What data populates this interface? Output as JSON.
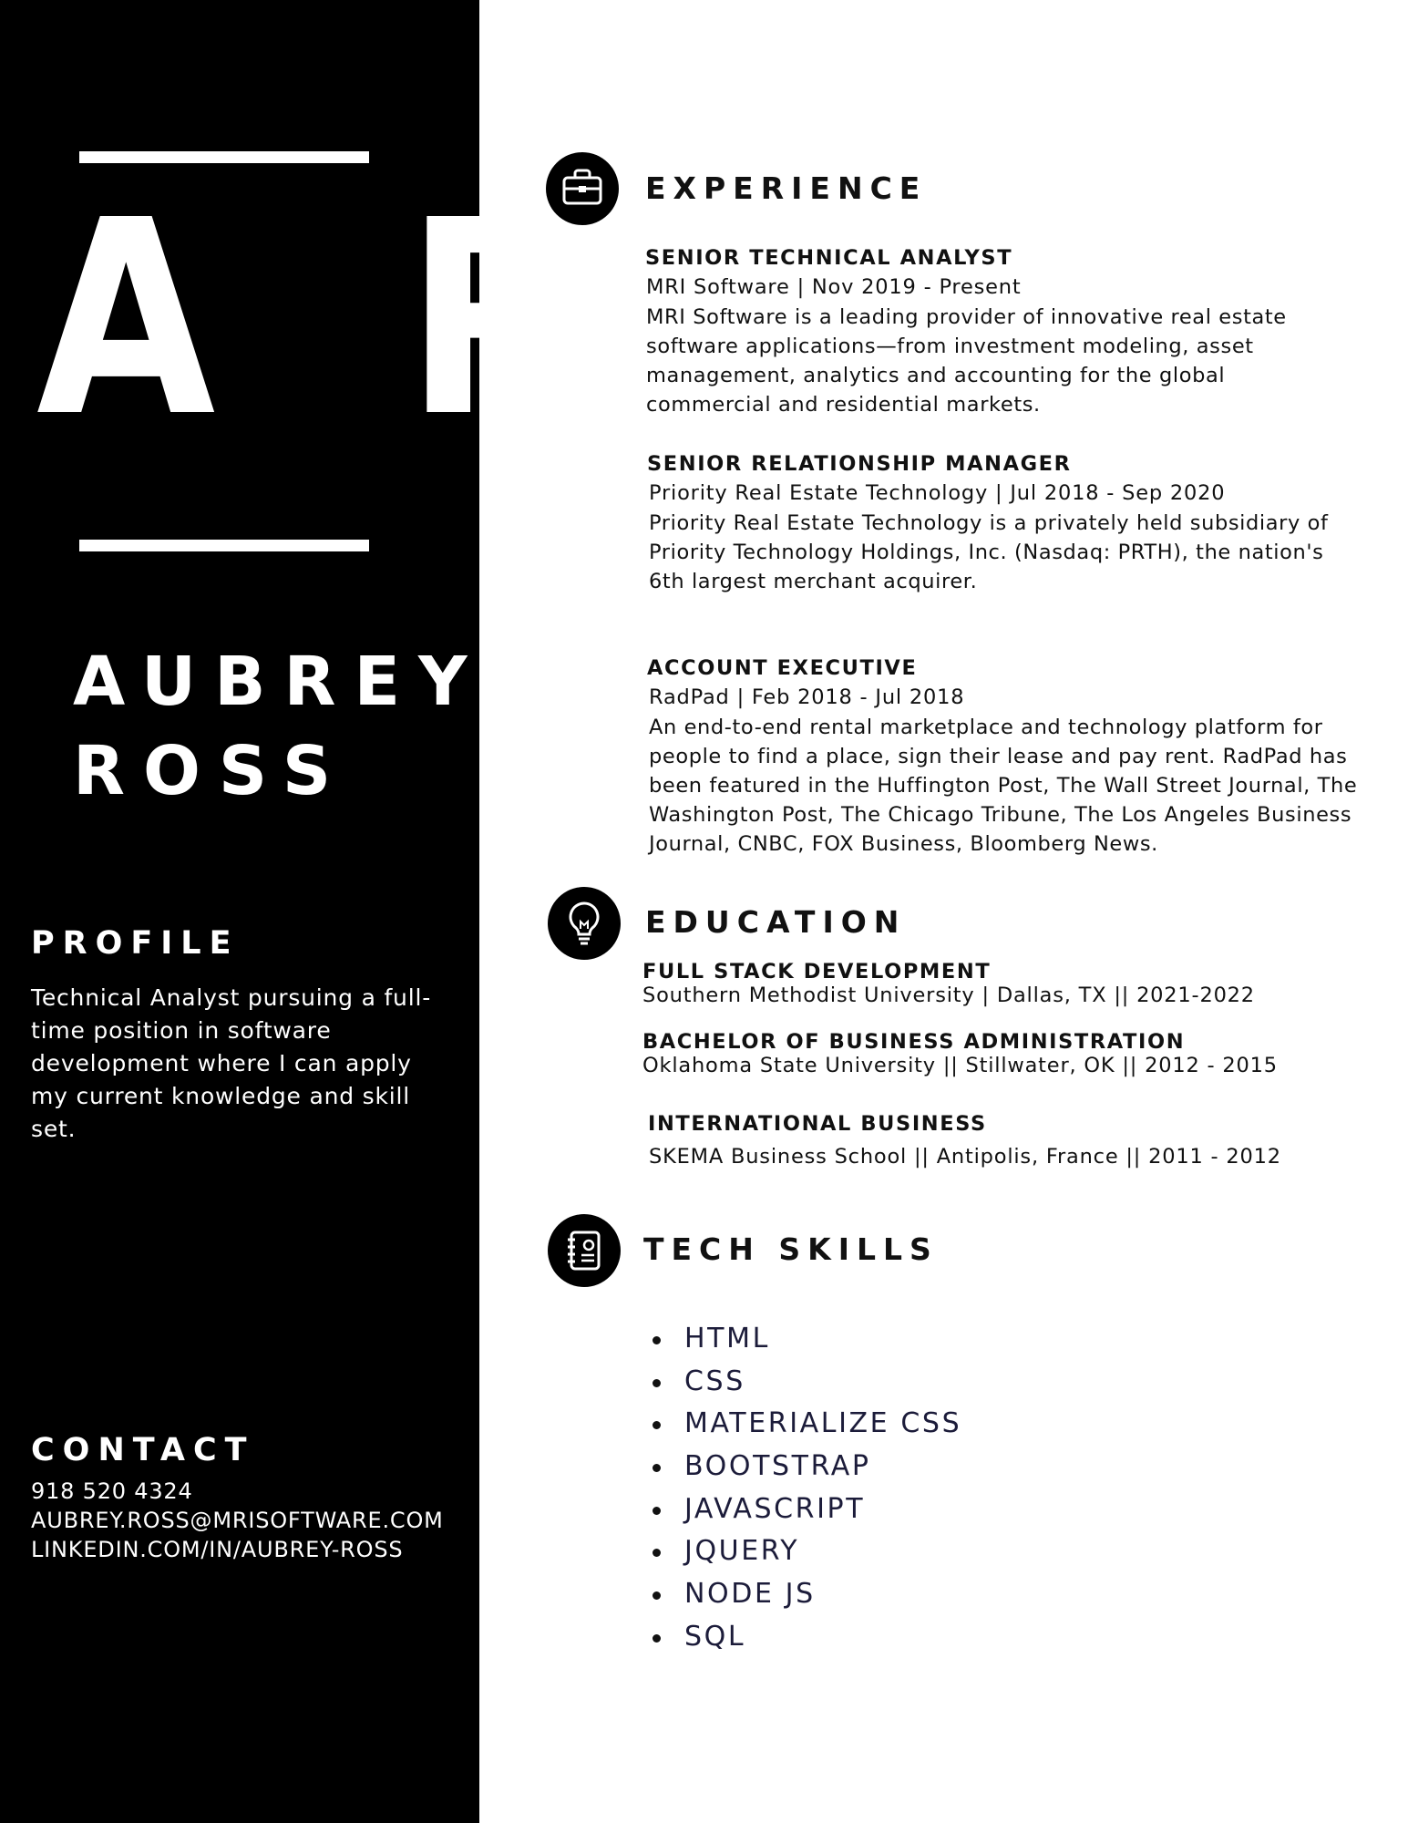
{
  "sidebar": {
    "monogram": "A R",
    "first_name": "AUBREY",
    "last_name": "ROSS",
    "profile_heading": "PROFILE",
    "profile_text": "Technical Analyst pursuing a full-time position in software development where I can apply my current knowledge and skill set.",
    "contact_heading": "CONTACT",
    "phone": "918 520 4324",
    "email": "AUBREY.ROSS@MRISOFTWARE.COM",
    "linkedin": "LINKEDIN.COM/IN/AUBREY-ROSS"
  },
  "experience": {
    "heading": "EXPERIENCE",
    "icon": "briefcase-icon",
    "jobs": [
      {
        "title": "SENIOR TECHNICAL ANALYST",
        "meta": "MRI Software  |  Nov 2019 - Present",
        "description": "MRI Software is a leading provider of innovative real estate software applications—from investment modeling, asset management, analytics and accounting for the global commercial and residential markets."
      },
      {
        "title": "SENIOR RELATIONSHIP MANAGER",
        "meta": "Priority Real Estate Technology  |  Jul 2018 - Sep 2020",
        "description": "Priority Real Estate Technology is a privately held subsidiary of Priority Technology Holdings, Inc. (Nasdaq: PRTH), the nation's 6th largest merchant acquirer."
      },
      {
        "title": "ACCOUNT EXECUTIVE",
        "meta": "RadPad  |  Feb 2018 - Jul 2018",
        "description": "An end-to-end rental marketplace and technology platform for people to find a place, sign their lease and pay rent. RadPad has been featured in the Huffington Post, The Wall Street Journal, The Washington Post, The Chicago Tribune, The Los Angeles Business Journal, CNBC, FOX Business, Bloomberg News."
      }
    ]
  },
  "education": {
    "heading": "EDUCATION",
    "icon": "lightbulb-icon",
    "entries": [
      {
        "degree": "FULL STACK DEVELOPMENT",
        "detail": "Southern Methodist University  | Dallas, TX || 2021-2022"
      },
      {
        "degree": "BACHELOR OF BUSINESS ADMINISTRATION",
        "detail": "Oklahoma State University  || Stillwater, OK ||  2012 - 2015"
      },
      {
        "degree": "INTERNATIONAL BUSINESS",
        "detail": "SKEMA Business School || Antipolis, France ||  2011 - 2012"
      }
    ]
  },
  "skills": {
    "heading": "TECH SKILLS",
    "icon": "notebook-icon",
    "items": [
      "HTML",
      "CSS",
      "MATERIALIZE CSS",
      "BOOTSTRAP",
      "JAVASCRIPT",
      "JQUERY",
      "NODE JS",
      "SQL"
    ]
  },
  "colors": {
    "sidebar_bg": "#000000",
    "sidebar_text": "#ffffff",
    "body_text": "#111111",
    "skill_text": "#1c1c3a"
  }
}
